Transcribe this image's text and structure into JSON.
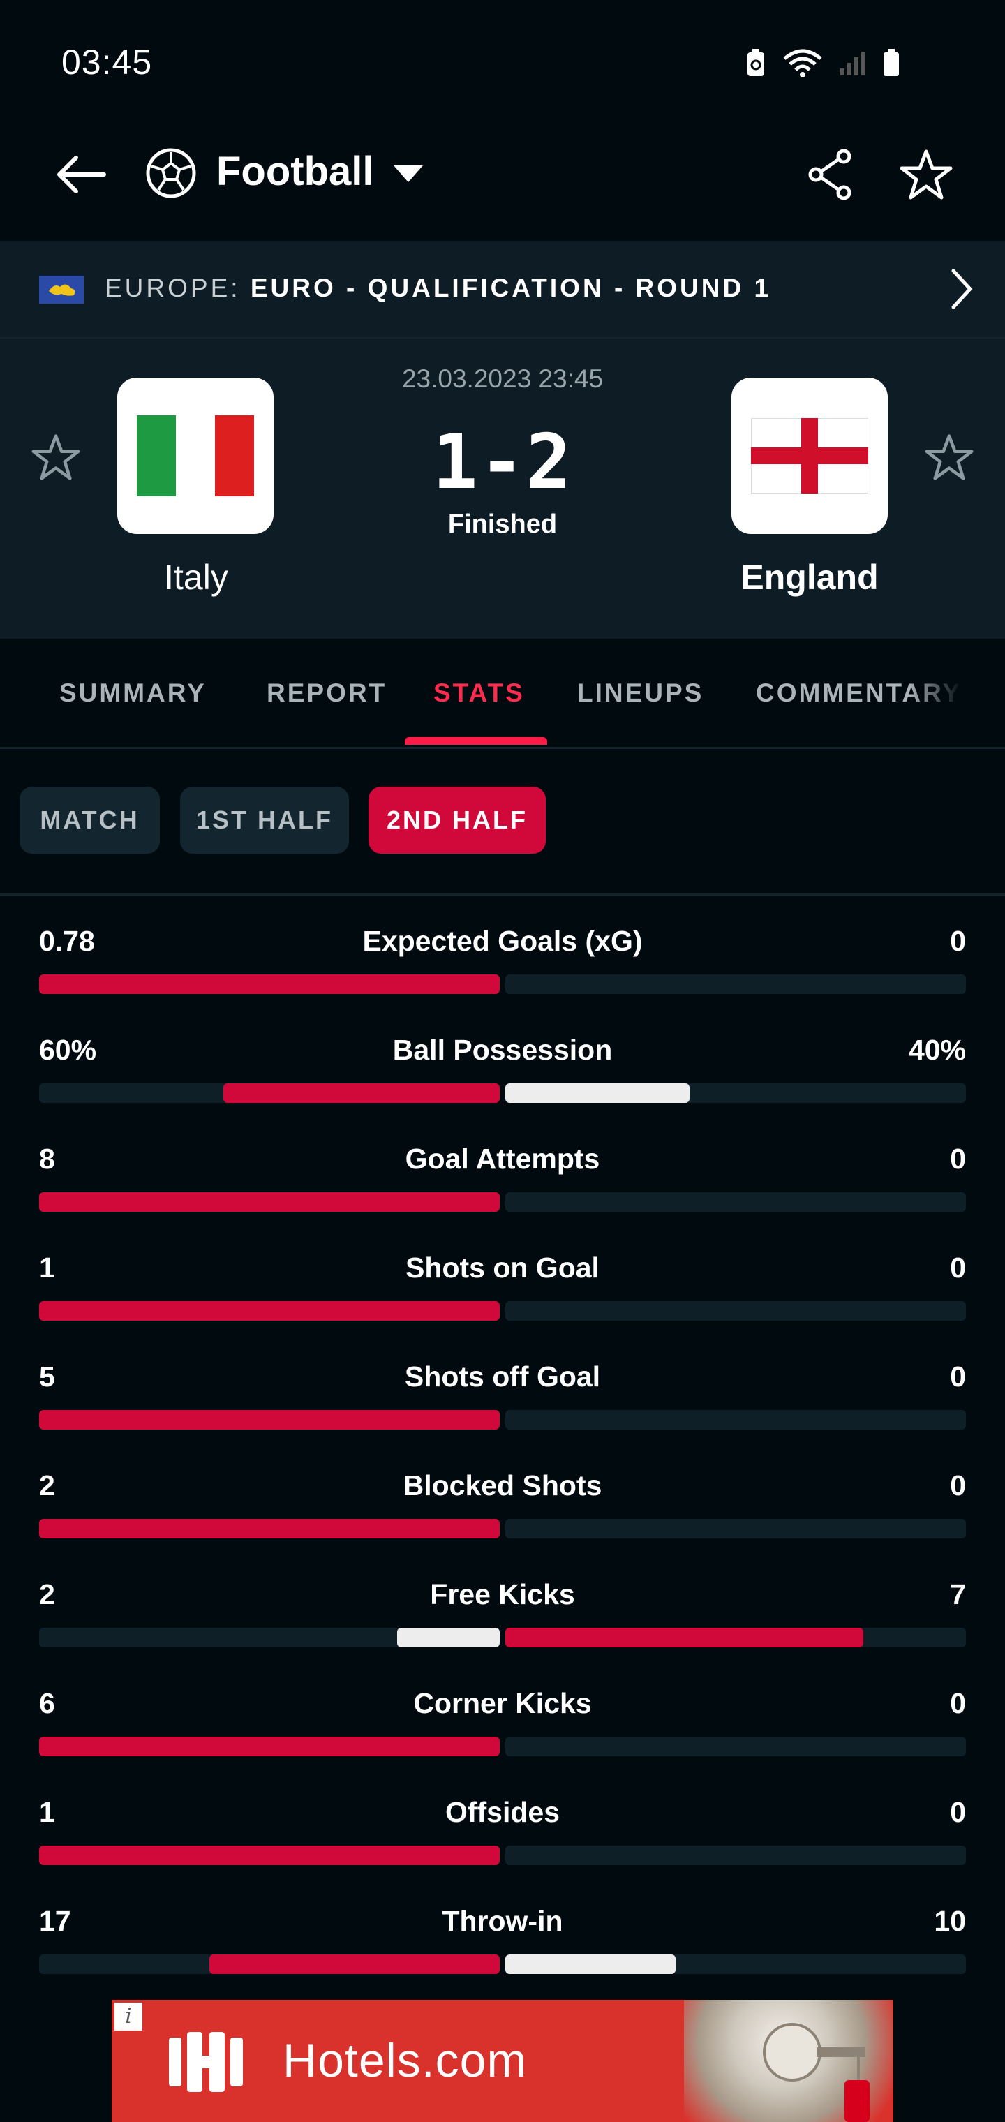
{
  "status_bar": {
    "time": "03:45"
  },
  "header": {
    "sport": "Football"
  },
  "league": {
    "prefix": "EUROPE: ",
    "name": "EURO - QUALIFICATION - ROUND 1"
  },
  "match": {
    "datetime": "23.03.2023 23:45",
    "score": "1-2",
    "status": "Finished",
    "home": {
      "name": "Italy"
    },
    "away": {
      "name": "England"
    }
  },
  "tabs": [
    "SUMMARY",
    "REPORT",
    "STATS",
    "LINEUPS",
    "COMMENTARY"
  ],
  "active_tab": "STATS",
  "periods": [
    "MATCH",
    "1ST HALF",
    "2ND HALF"
  ],
  "active_period": "2ND HALF",
  "colors": {
    "accent": "#d0093a",
    "leading_bar": "#d0093a",
    "trailing_bar": "#ededed",
    "track": "#0e1f28"
  },
  "stats": [
    {
      "label": "Expected Goals (xG)",
      "home": "0.78",
      "away": "0",
      "home_share": 1.0,
      "away_share": 0.0
    },
    {
      "label": "Ball Possession",
      "home": "60%",
      "away": "40%",
      "home_share": 0.6,
      "away_share": 0.4
    },
    {
      "label": "Goal Attempts",
      "home": "8",
      "away": "0",
      "home_share": 1.0,
      "away_share": 0.0
    },
    {
      "label": "Shots on Goal",
      "home": "1",
      "away": "0",
      "home_share": 1.0,
      "away_share": 0.0
    },
    {
      "label": "Shots off Goal",
      "home": "5",
      "away": "0",
      "home_share": 1.0,
      "away_share": 0.0
    },
    {
      "label": "Blocked Shots",
      "home": "2",
      "away": "0",
      "home_share": 1.0,
      "away_share": 0.0
    },
    {
      "label": "Free Kicks",
      "home": "2",
      "away": "7",
      "home_share": 0.222,
      "away_share": 0.778
    },
    {
      "label": "Corner Kicks",
      "home": "6",
      "away": "0",
      "home_share": 1.0,
      "away_share": 0.0
    },
    {
      "label": "Offsides",
      "home": "1",
      "away": "0",
      "home_share": 1.0,
      "away_share": 0.0
    },
    {
      "label": "Throw-in",
      "home": "17",
      "away": "10",
      "home_share": 0.63,
      "away_share": 0.37
    }
  ],
  "ad": {
    "brand": "Hotels.com",
    "info": "i"
  }
}
